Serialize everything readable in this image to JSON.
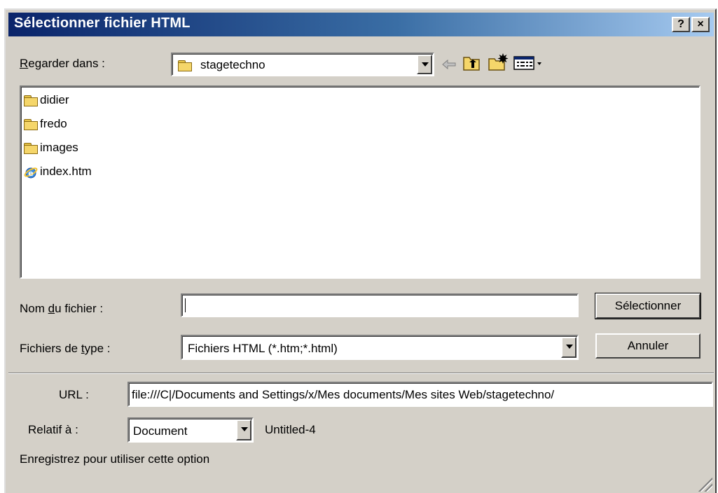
{
  "window": {
    "title": "Sélectionner fichier HTML",
    "help_btn": "?",
    "close_btn": "×"
  },
  "lookin": {
    "label_prefix": "",
    "label_ul": "R",
    "label_rest": "egarder dans :",
    "value": "stagetechno"
  },
  "files": [
    {
      "name": "didier",
      "icon": "folder-icon"
    },
    {
      "name": "fredo",
      "icon": "folder-icon"
    },
    {
      "name": "images",
      "icon": "folder-icon"
    },
    {
      "name": "index.htm",
      "icon": "ie-document-icon"
    }
  ],
  "filename": {
    "label_prefix": "Nom ",
    "label_ul": "d",
    "label_rest": "u fichier :",
    "value": ""
  },
  "filetype": {
    "label_prefix": "Fichiers de ",
    "label_ul": "t",
    "label_rest": "ype :",
    "value": "Fichiers HTML (*.htm;*.html)"
  },
  "buttons": {
    "select": "Sélectionner",
    "cancel": "Annuler"
  },
  "url": {
    "label": "URL :",
    "value": "file:///C|/Documents and Settings/x/Mes documents/Mes sites Web/stagetechno/"
  },
  "relative": {
    "label": "Relatif à :",
    "value": "Document",
    "doc_name": "Untitled-4"
  },
  "hint": "Enregistrez pour utiliser cette option",
  "colors": {
    "title_start": "#0a246a",
    "title_end": "#a6caf0",
    "face": "#d4d0c8"
  }
}
